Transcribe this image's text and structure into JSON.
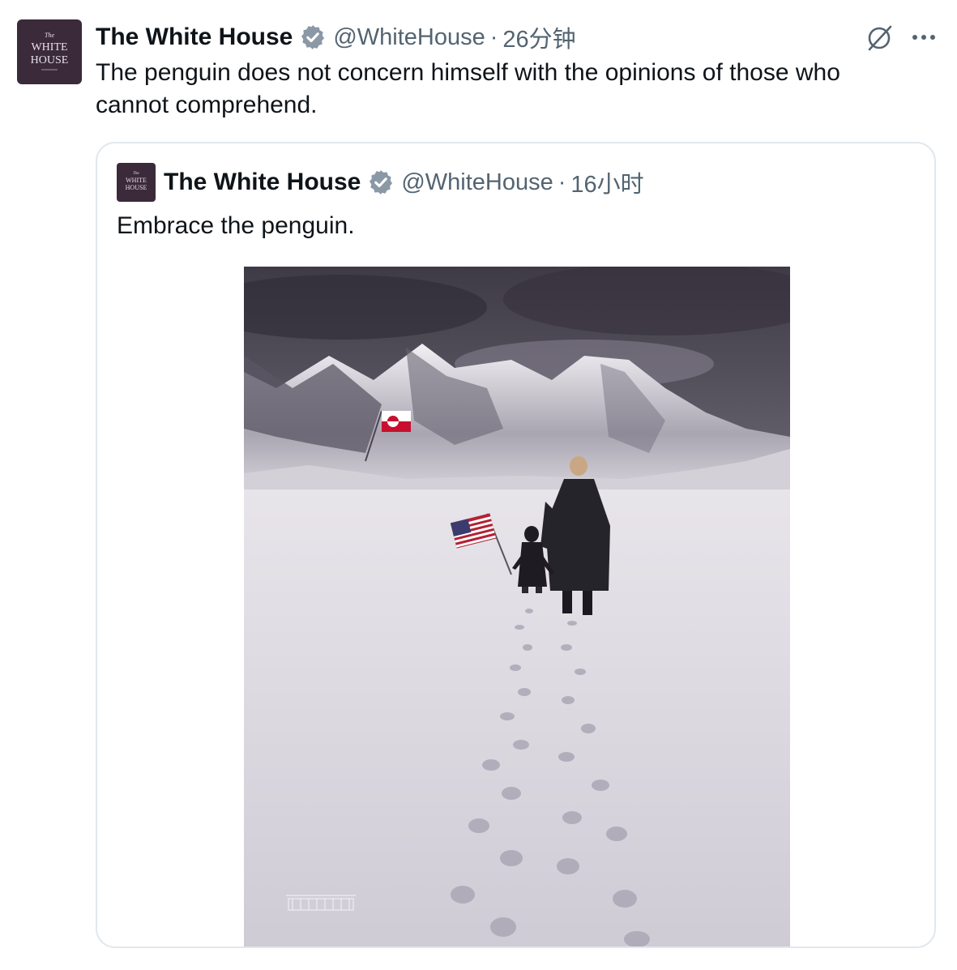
{
  "tweet": {
    "author": {
      "name": "The White House",
      "handle": "@WhiteHouse",
      "avatar_text_1": "The",
      "avatar_text_2": "WHITE",
      "avatar_text_3": "HOUSE"
    },
    "separator": "·",
    "time": "26分钟",
    "text": "The penguin does not concern himself with the opinions of those who cannot comprehend.",
    "icons": {
      "verified": "verified-badge-icon",
      "grok": "grok-icon",
      "more": "more-icon"
    }
  },
  "quoted_tweet": {
    "author": {
      "name": "The White House",
      "handle": "@WhiteHouse"
    },
    "separator": "·",
    "time": "16小时",
    "text": "Embrace the penguin.",
    "media": {
      "content": "image"
    }
  },
  "colors": {
    "text_primary": "#0f1419",
    "text_secondary": "#536471",
    "avatar_bg": "#3b2a3a",
    "border": "#e1e8ed",
    "verified": "#8b98a5"
  }
}
